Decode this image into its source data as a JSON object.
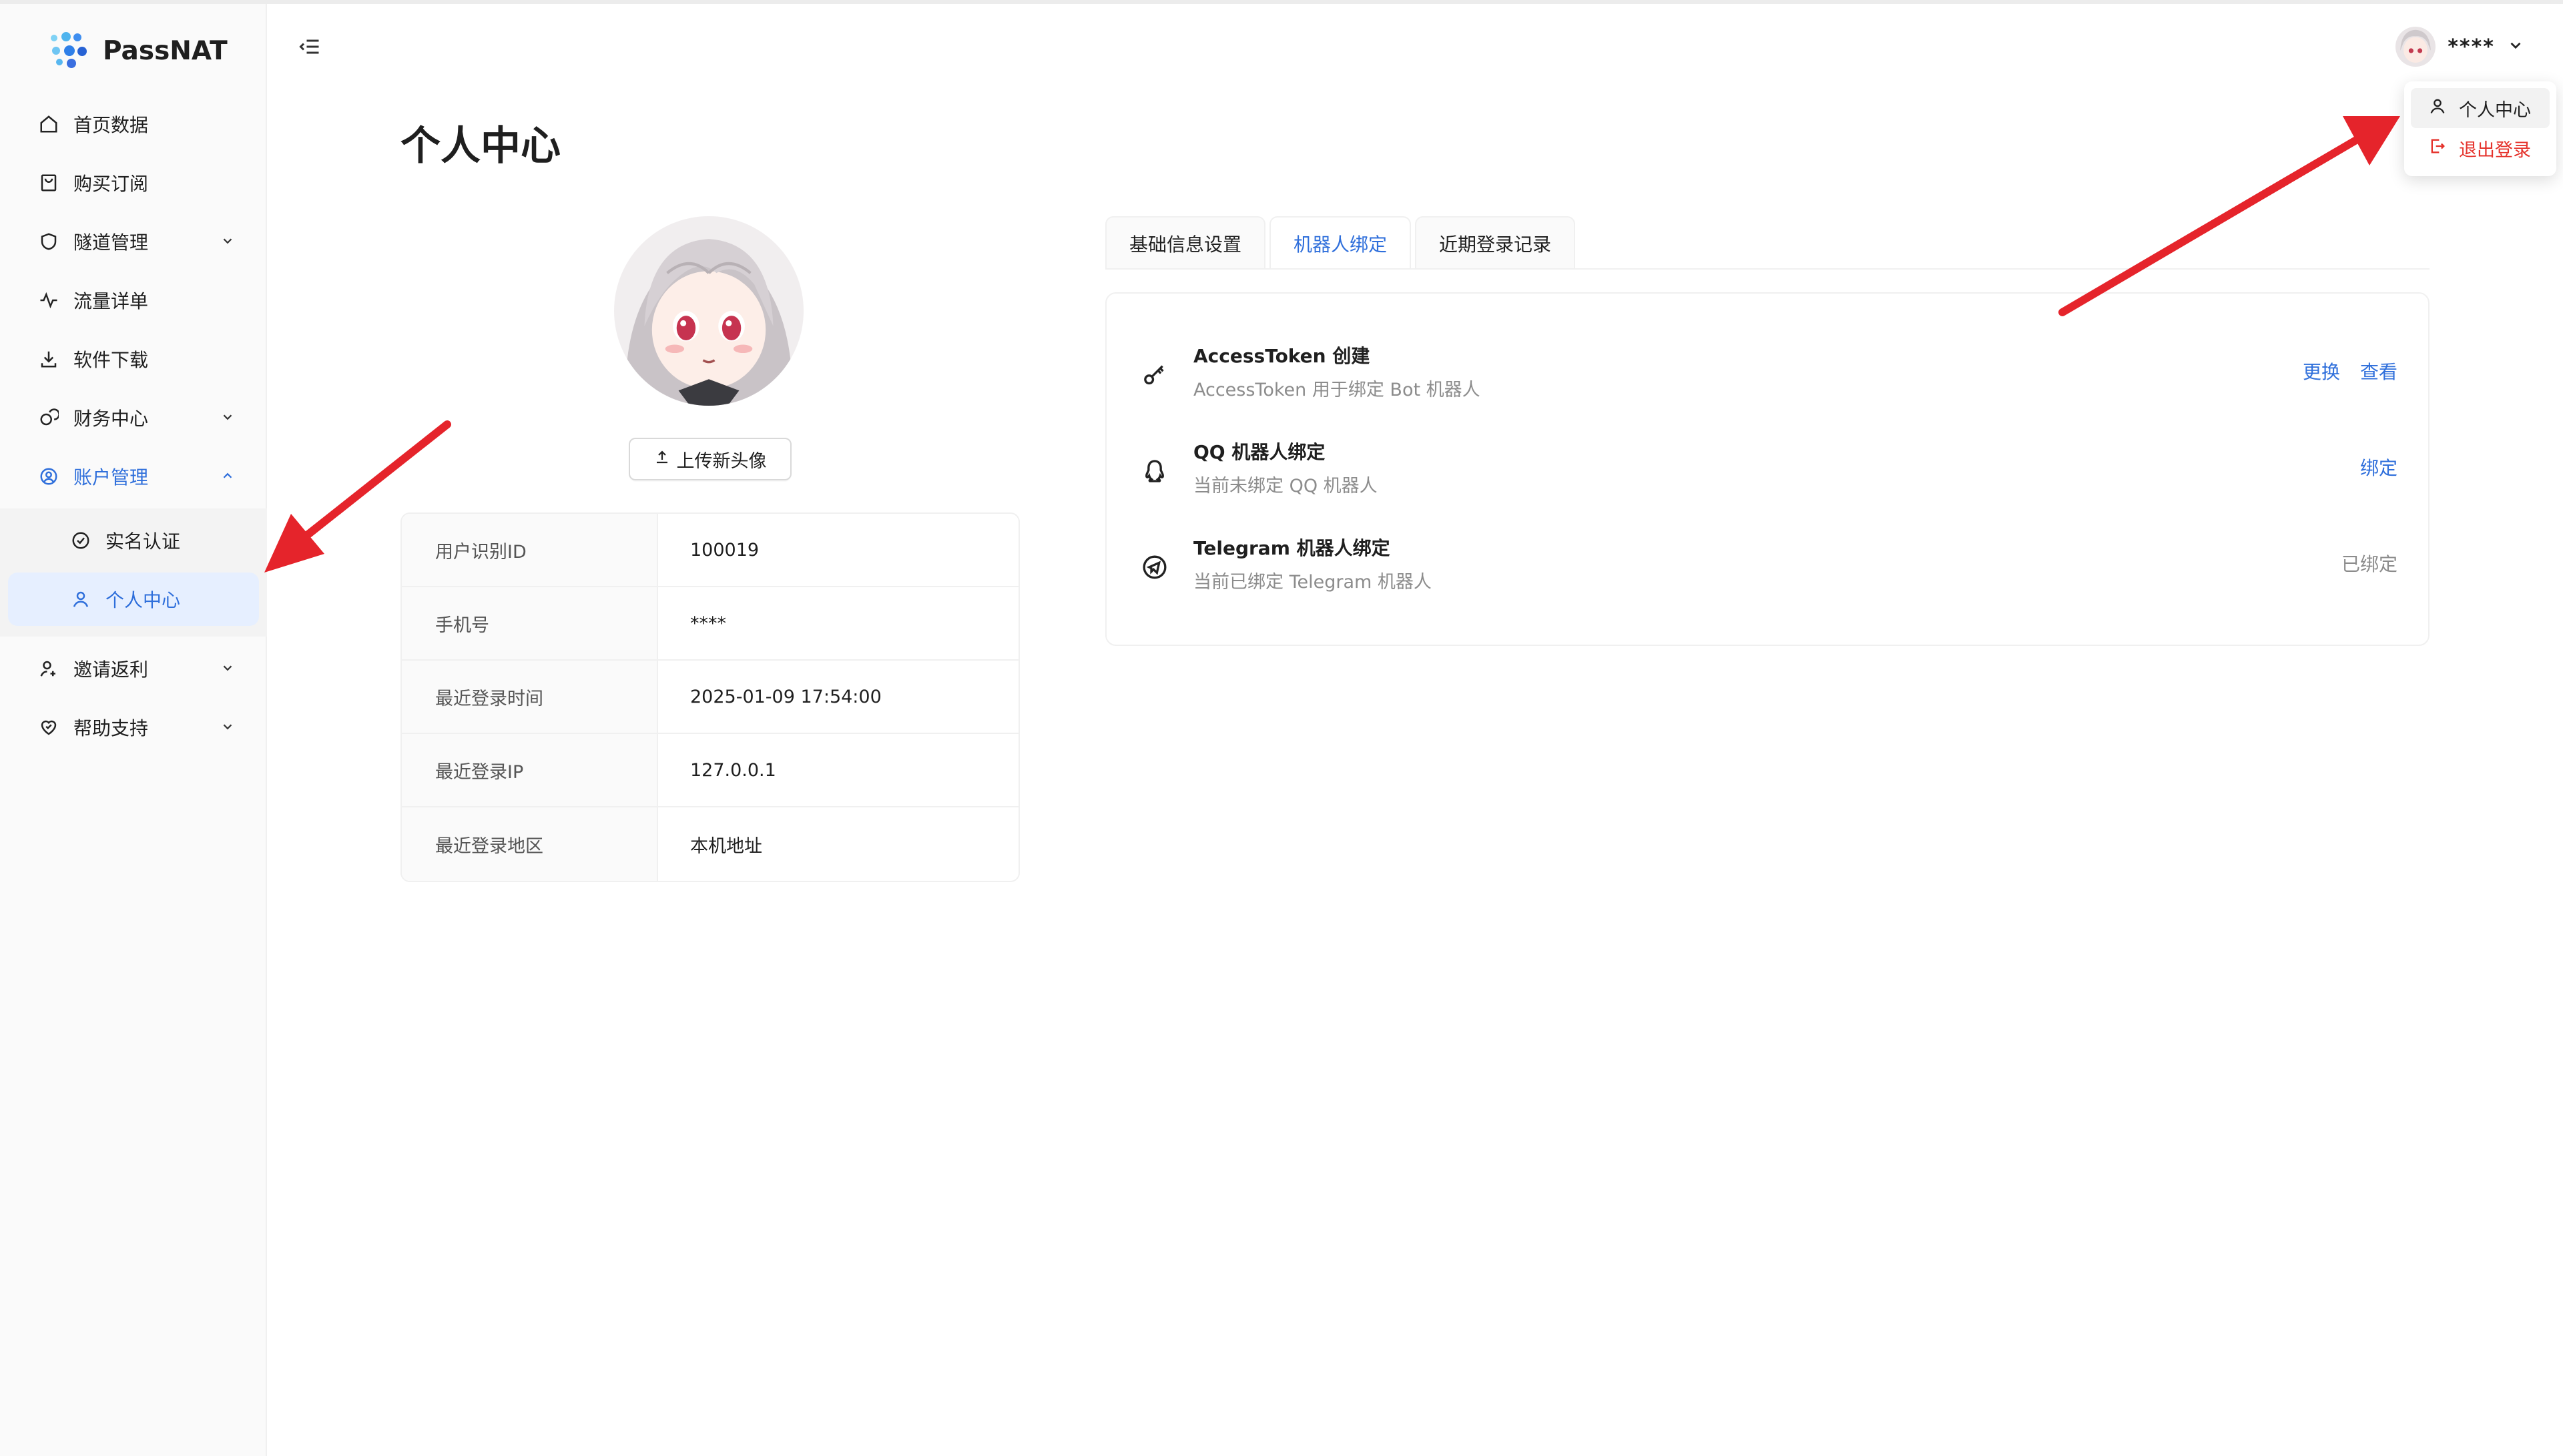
{
  "brand": {
    "name": "PassNAT"
  },
  "sidebar": {
    "items": [
      {
        "label": "首页数据",
        "icon": "home-icon"
      },
      {
        "label": "购买订阅",
        "icon": "shopping-bag-icon"
      },
      {
        "label": "隧道管理",
        "icon": "shield-icon",
        "expandable": true
      },
      {
        "label": "流量详单",
        "icon": "activity-icon"
      },
      {
        "label": "软件下载",
        "icon": "download-icon"
      },
      {
        "label": "财务中心",
        "icon": "finance-icon",
        "expandable": true
      },
      {
        "label": "账户管理",
        "icon": "user-circle-icon",
        "expandable": true,
        "open": true
      },
      {
        "label": "邀请返利",
        "icon": "user-add-icon",
        "expandable": true
      },
      {
        "label": "帮助支持",
        "icon": "heart-handshake-icon",
        "expandable": true
      }
    ],
    "submenu": [
      {
        "label": "实名认证",
        "icon": "check-circle-icon"
      },
      {
        "label": "个人中心",
        "icon": "user-icon",
        "active": true
      }
    ]
  },
  "header": {
    "username": "****",
    "dropdown": [
      {
        "label": "个人中心",
        "icon": "user-icon"
      },
      {
        "label": "退出登录",
        "icon": "logout-icon"
      }
    ]
  },
  "page": {
    "title": "个人中心",
    "upload_label": "上传新头像",
    "info": [
      {
        "key": "用户识别ID",
        "value": "100019"
      },
      {
        "key": "手机号",
        "value": "****"
      },
      {
        "key": "最近登录时间",
        "value": "2025-01-09 17:54:00"
      },
      {
        "key": "最近登录IP",
        "value": "127.0.0.1"
      },
      {
        "key": "最近登录地区",
        "value": "本机地址"
      }
    ],
    "tabs": [
      {
        "label": "基础信息设置"
      },
      {
        "label": "机器人绑定",
        "active": true
      },
      {
        "label": "近期登录记录"
      }
    ],
    "bindings": [
      {
        "title": "AccessToken 创建",
        "desc": "AccessToken 用于绑定 Bot 机器人",
        "icon": "key-icon",
        "actions": [
          "更换",
          "查看"
        ]
      },
      {
        "title": "QQ 机器人绑定",
        "desc": "当前未绑定 QQ 机器人",
        "icon": "qq-icon",
        "actions": [
          "绑定"
        ]
      },
      {
        "title": "Telegram 机器人绑定",
        "desc": "当前已绑定 Telegram 机器人",
        "icon": "telegram-icon",
        "status": "已绑定"
      }
    ]
  },
  "colors": {
    "accent": "#2f6fdb",
    "danger": "#e5332c",
    "annotation": "#e5242b"
  }
}
